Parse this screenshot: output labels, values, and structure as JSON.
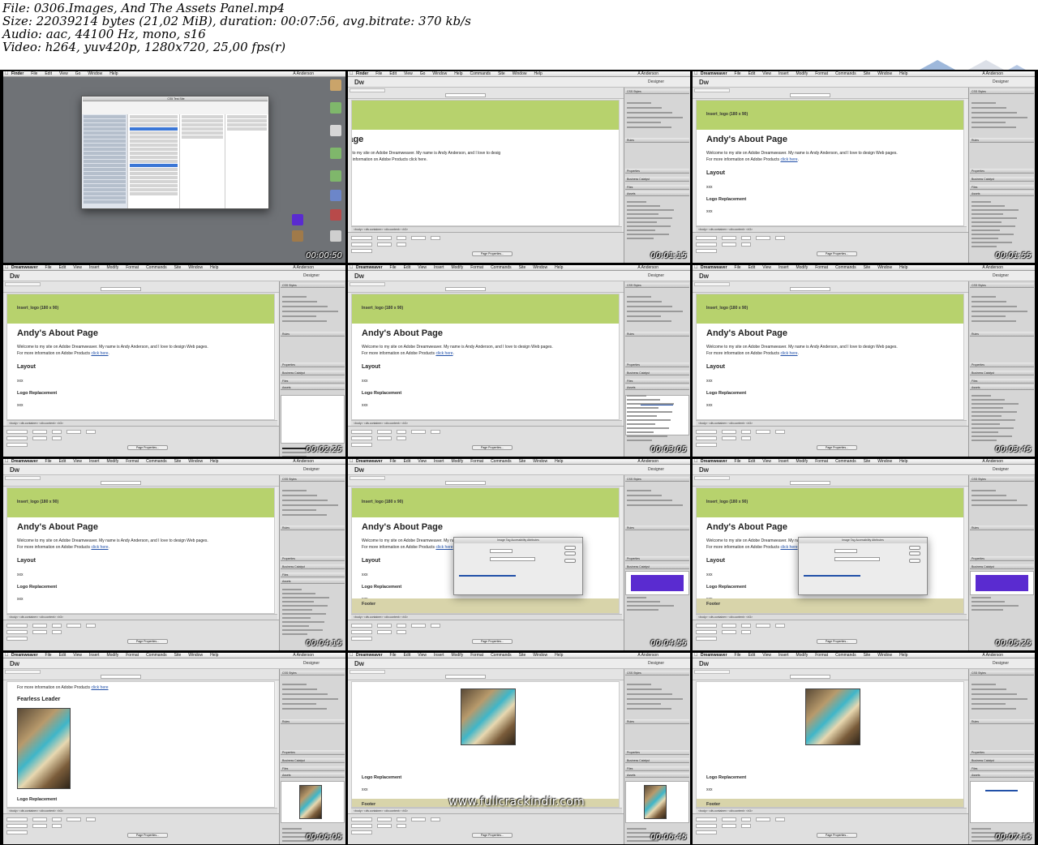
{
  "info": {
    "file": "File: 0306.Images, And The Assets Panel.mp4",
    "size": "Size: 22039214 bytes (21,02 MiB), duration: 00:07:56, avg.bitrate: 370 kb/s",
    "audio": "Audio: aac, 44100 Hz, mono, s16",
    "video": "Video: h264, yuv420p, 1280x720, 25,00 fps(r)"
  },
  "watermark": "www.fullcrackindir.com",
  "dw": {
    "menus": [
      "Dreamweaver",
      "File",
      "Edit",
      "View",
      "Insert",
      "Modify",
      "Format",
      "Commands",
      "Site",
      "Window",
      "Help"
    ],
    "finder_menus": [
      "Finder",
      "File",
      "Edit",
      "View",
      "Go",
      "Window",
      "Help"
    ],
    "user": "A Anderson",
    "logo": "Dw",
    "workspace": "Designer",
    "logo_placeholder": "Insert_logo (180 x 90)",
    "heading": "Andy's About Page",
    "body1": "Welcome to my site on Adobe Dreamweaver. My name is Andy Anderson, and I love to design Web pages.",
    "body2": "For more information on Adobe Products",
    "link": "click here",
    "layout": "Layout",
    "xxx": "xxx",
    "logo_replacement": "Logo Replacement",
    "footer": "Footer",
    "fearless": "Fearless Leader",
    "status": "<body> <div.container> <div.content> <h3>",
    "page_props": "Page Properties...",
    "panel_headers": [
      "CSS Styles",
      "Rules",
      "Properties",
      "Business Catalyst",
      "Files",
      "Assets"
    ],
    "dialog_title": "Image Tag Accessibility Attributes",
    "finder_title": "CS5 Test Site"
  },
  "tiles": [
    {
      "ts": "00:00:50",
      "variant": "finder"
    },
    {
      "ts": "00:01:15",
      "variant": "partial"
    },
    {
      "ts": "00:01:55",
      "variant": "about"
    },
    {
      "ts": "00:02:25",
      "variant": "about"
    },
    {
      "ts": "00:03:05",
      "variant": "about"
    },
    {
      "ts": "00:03:45",
      "variant": "about"
    },
    {
      "ts": "00:04:15",
      "variant": "about"
    },
    {
      "ts": "00:04:55",
      "variant": "dialog"
    },
    {
      "ts": "00:05:25",
      "variant": "dialog"
    },
    {
      "ts": "00:06:05",
      "variant": "image"
    },
    {
      "ts": "00:06:45",
      "variant": "centered-image"
    },
    {
      "ts": "00:07:15",
      "variant": "centered-image"
    }
  ]
}
